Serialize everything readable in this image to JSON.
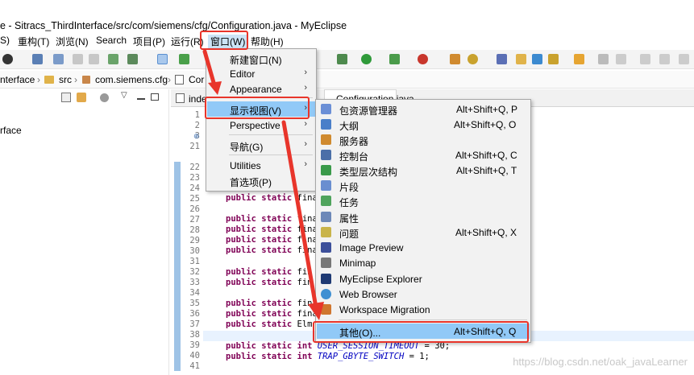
{
  "window_title": "e - Sitracs_ThirdInterface/src/com/siemens/cfg/Configuration.java - MyEclipse",
  "menubar": {
    "items": [
      "S)",
      "重构(T)",
      "浏览(N)",
      "Search",
      "项目(P)",
      "运行(R)",
      "窗口(W)",
      "帮助(H)"
    ]
  },
  "breadcrumb": {
    "project": "nterface",
    "src": "src",
    "package": "com.siemens.cfg",
    "class": "Cor"
  },
  "left_panel": {
    "item": "rface"
  },
  "editor": {
    "tab_background": "inde",
    "tab_active": "Configuration.java",
    "line_numbers": [
      "1",
      "2",
      "3",
      "21",
      "22",
      "23",
      "24",
      "25",
      "26",
      "27",
      "28",
      "29",
      "30",
      "31",
      "32",
      "33",
      "34",
      "35",
      "36",
      "37",
      "38",
      "39",
      "40",
      "41"
    ],
    "code_lines": [
      {
        "kw": "public static",
        "rest": " fina"
      },
      {
        "kw": "public static",
        "rest": " fina"
      },
      {
        "kw": "public static",
        "rest": " fina"
      },
      {
        "kw": "public static",
        "rest": " fina"
      },
      {
        "kw": "public static",
        "rest": " fina"
      },
      {
        "kw": "public static",
        "rest": " fin"
      },
      {
        "kw": "public static",
        "rest": " fin"
      },
      {
        "kw": "public static",
        "rest": " fina"
      },
      {
        "kw": "public static",
        "rest": " fina"
      },
      {
        "kw": "public static",
        "rest": " Elm"
      },
      {
        "kw": "public static int",
        "cst": "USER_SESSION_TIMEOUT",
        "rest": " = 30;"
      },
      {
        "kw": "public static int",
        "cst": "TRAP_GBYTE_SWITCH",
        "rest": " = 1;"
      }
    ]
  },
  "window_menu": {
    "items": [
      {
        "label": "新建窗口(N)",
        "submenu": false
      },
      {
        "label": "Editor",
        "submenu": true
      },
      {
        "label": "Appearance",
        "submenu": true
      },
      {
        "label": "显示视图(V)",
        "submenu": true,
        "selected": true
      },
      {
        "label": "Perspective",
        "submenu": true
      },
      {
        "label": "导航(G)",
        "submenu": true
      },
      {
        "label": "Utilities",
        "submenu": true
      },
      {
        "label": "首选项(P)",
        "submenu": false
      }
    ]
  },
  "show_view_menu": {
    "items": [
      {
        "label": "包资源管理器",
        "shortcut": "Alt+Shift+Q, P",
        "icon": "package-explorer-icon",
        "color": "#6b8fd6"
      },
      {
        "label": "大纲",
        "shortcut": "Alt+Shift+Q, O",
        "icon": "outline-icon",
        "color": "#4a7fc9"
      },
      {
        "label": "服务器",
        "shortcut": "",
        "icon": "servers-icon",
        "color": "#d08a2f"
      },
      {
        "label": "控制台",
        "shortcut": "Alt+Shift+Q, C",
        "icon": "console-icon",
        "color": "#4b6fa8"
      },
      {
        "label": "类型层次结构",
        "shortcut": "Alt+Shift+Q, T",
        "icon": "type-hierarchy-icon",
        "color": "#3a9a4a"
      },
      {
        "label": "片段",
        "shortcut": "",
        "icon": "snippets-icon",
        "color": "#6a8ed0"
      },
      {
        "label": "任务",
        "shortcut": "",
        "icon": "tasks-icon",
        "color": "#4fa35c"
      },
      {
        "label": "属性",
        "shortcut": "",
        "icon": "properties-icon",
        "color": "#6d88b8"
      },
      {
        "label": "问题",
        "shortcut": "Alt+Shift+Q, X",
        "icon": "problems-icon",
        "color": "#c9b44a"
      },
      {
        "label": "Image Preview",
        "shortcut": "",
        "icon": "image-preview-icon",
        "color": "#3c4f9a"
      },
      {
        "label": "Minimap",
        "shortcut": "",
        "icon": "minimap-icon",
        "color": "#777777"
      },
      {
        "label": "MyEclipse Explorer",
        "shortcut": "",
        "icon": "myeclipse-explorer-icon",
        "color": "#1f3a73"
      },
      {
        "label": "Web Browser",
        "shortcut": "",
        "icon": "web-browser-icon",
        "color": "#3f8fd2"
      },
      {
        "label": "Workspace Migration",
        "shortcut": "",
        "icon": "workspace-migration-icon",
        "color": "#d0762e"
      },
      {
        "label": "其他(O)...",
        "shortcut": "Alt+Shift+Q, Q",
        "icon": "",
        "color": "",
        "selected": true
      }
    ]
  },
  "colors": {
    "annotation_red": "#e8352b",
    "menu_selection": "#91c9f7",
    "keyword": "#7f0055",
    "constant": "#0000c0"
  },
  "watermark": "https://blog.csdn.net/oak_javaLearner"
}
